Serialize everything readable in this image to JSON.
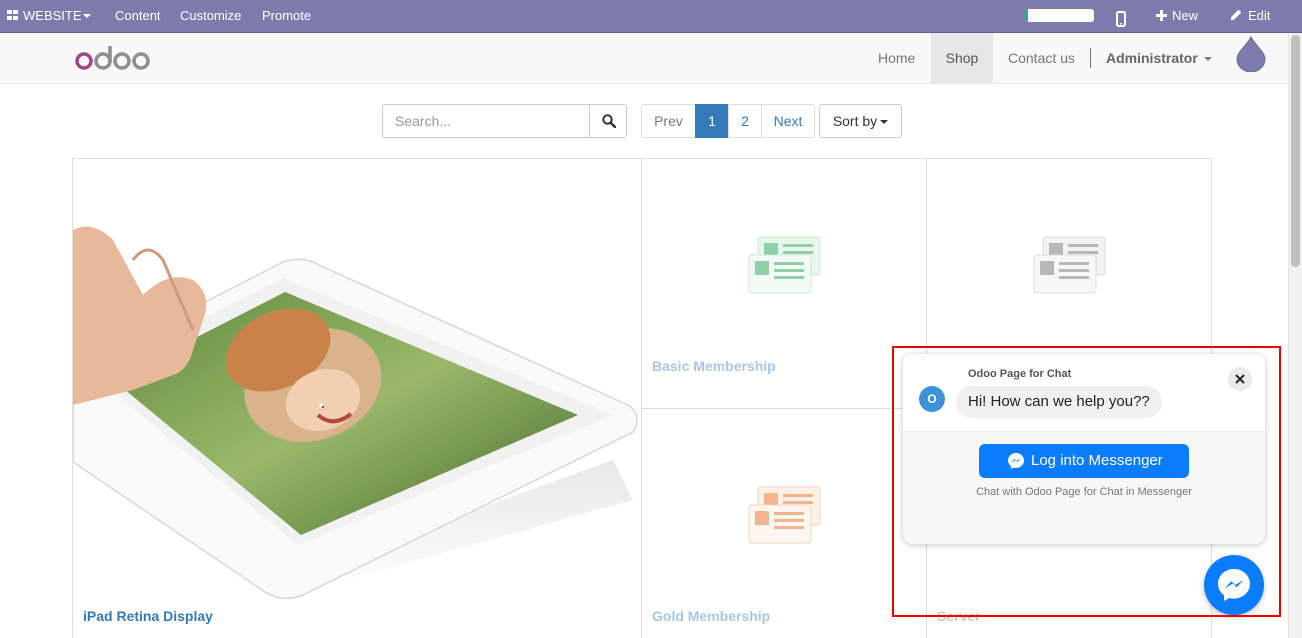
{
  "adminbar": {
    "website_label": "WEBSITE",
    "content_label": "Content",
    "customize_label": "Customize",
    "promote_label": "Promote",
    "new_label": "New",
    "edit_label": "Edit",
    "progress_fraction": 0.05
  },
  "header": {
    "logo_text": "odoo",
    "nav": {
      "home": "Home",
      "shop": "Shop",
      "contact": "Contact us",
      "user": "Administrator"
    }
  },
  "shop": {
    "search_placeholder": "Search...",
    "pager": {
      "prev": "Prev",
      "page1": "1",
      "page2": "2",
      "next": "Next"
    },
    "sort_label": "Sort by",
    "products": [
      {
        "name": "iPad Retina Display"
      },
      {
        "name": "Basic Membership"
      },
      {
        "name": "Gold Membership"
      },
      {
        "name": "Server"
      }
    ]
  },
  "messenger": {
    "page_name": "Odoo Page for Chat",
    "avatar_letter": "O",
    "greeting": "Hi! How can we help you??",
    "login_label": "Log into Messenger",
    "subtitle": "Chat with Odoo Page for Chat in Messenger"
  },
  "colors": {
    "adminbar": "#7c7bad",
    "link": "#337ab7",
    "messenger_blue": "#0a7cff",
    "highlight_border": "#e00000"
  }
}
